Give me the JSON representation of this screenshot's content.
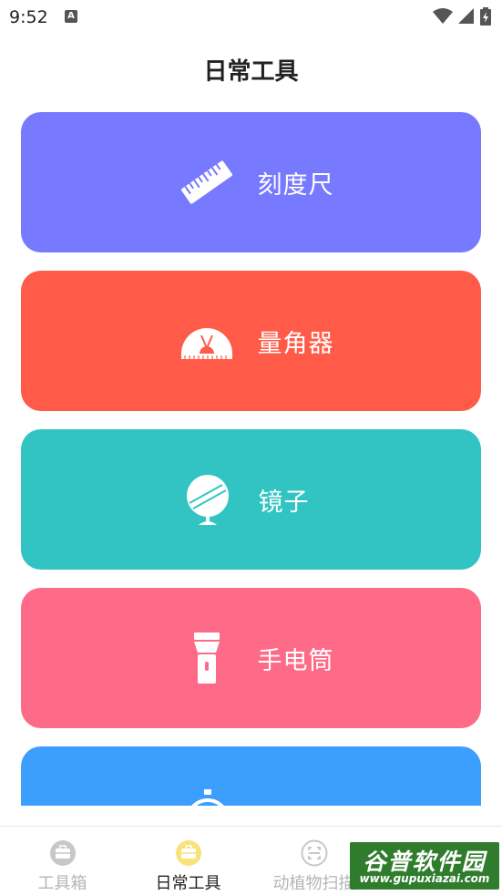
{
  "status_bar": {
    "time": "9:52",
    "notification_icon": "a-badge-icon",
    "icons": [
      "wifi-icon",
      "signal-icon",
      "battery-icon"
    ]
  },
  "header": {
    "title": "日常工具"
  },
  "tools": [
    {
      "label": "刻度尺",
      "icon": "ruler-icon",
      "color": "#7779FE"
    },
    {
      "label": "量角器",
      "icon": "protractor-icon",
      "color": "#FF5B48"
    },
    {
      "label": "镜子",
      "icon": "mirror-icon",
      "color": "#32C4C3"
    },
    {
      "label": "手电筒",
      "icon": "flashlight-icon",
      "color": "#FE6B88"
    },
    {
      "label": "",
      "icon": "stopwatch-icon",
      "color": "#3C9EFD"
    }
  ],
  "bottom_nav": {
    "items": [
      {
        "label": "工具箱",
        "icon": "toolbox-icon",
        "active": false
      },
      {
        "label": "日常工具",
        "icon": "daily-tools-icon",
        "active": true
      },
      {
        "label": "动植物扫描",
        "icon": "scan-icon",
        "active": false
      }
    ],
    "active_color": "#F8E27A",
    "inactive_color": "#C8C8C8"
  },
  "watermark": {
    "title": "谷普软件园",
    "url": "www.gupuxiazai.com"
  }
}
